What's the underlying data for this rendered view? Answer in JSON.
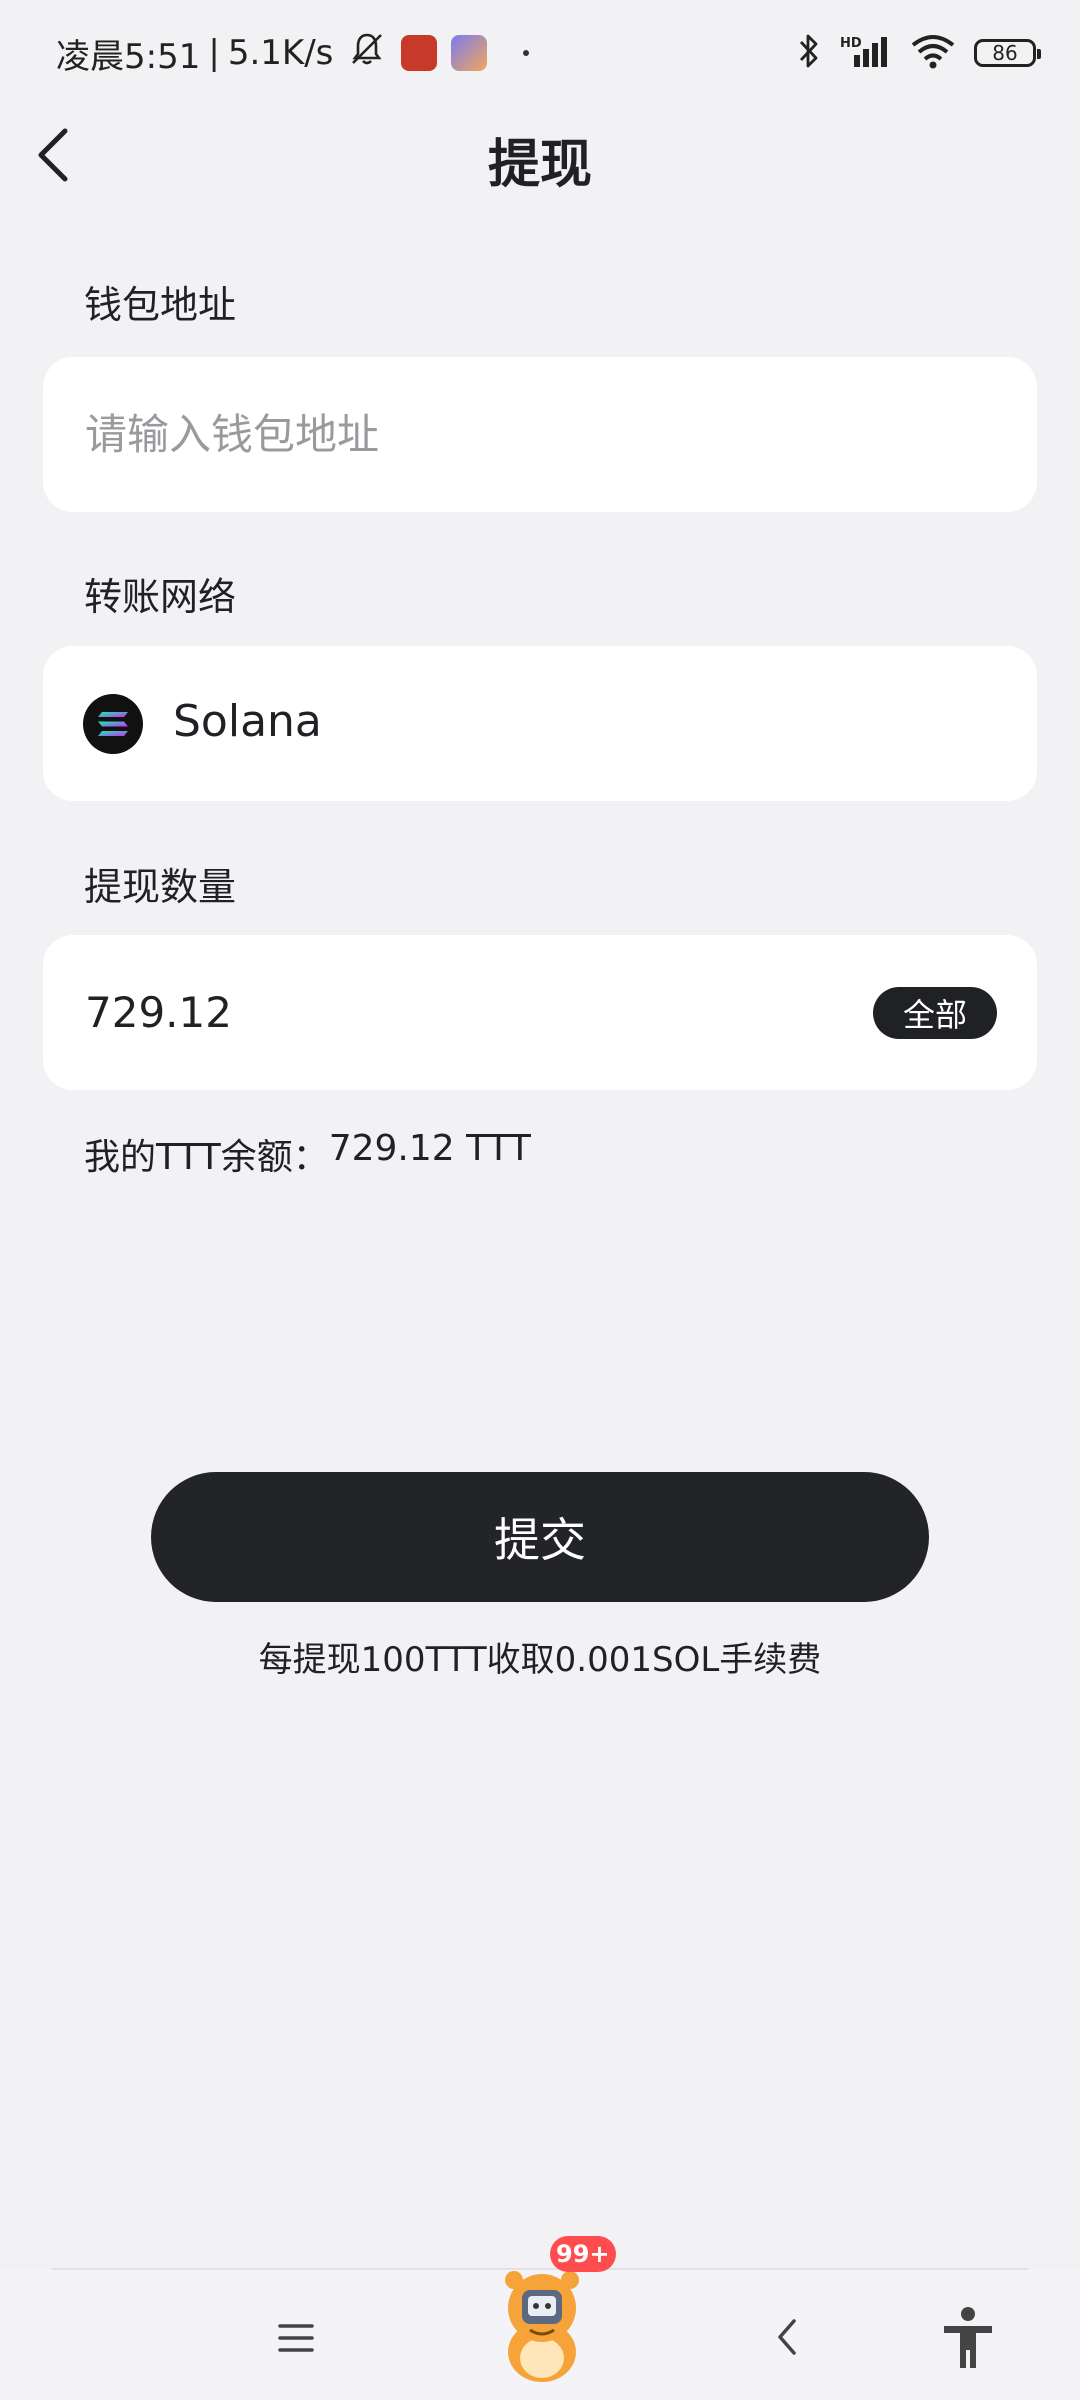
{
  "status_bar": {
    "time": "凌晨5:51",
    "separator": "|",
    "net_speed": "5.1K/s",
    "battery": "86",
    "signal_label": "HD"
  },
  "header": {
    "title": "提现"
  },
  "wallet": {
    "label": "钱包地址",
    "value": "",
    "placeholder": "请输入钱包地址"
  },
  "network": {
    "label": "转账网络",
    "selected": "Solana",
    "icon": "solana-icon"
  },
  "amount": {
    "label": "提现数量",
    "value": "729.12",
    "all_button": "全部"
  },
  "balance": {
    "prefix": "我的TTT余额：",
    "value": "729.12 TTT"
  },
  "submit": {
    "label": "提交"
  },
  "fee_note": "每提现100TTT收取0.001SOL手续费",
  "nav": {
    "badge": "99+"
  },
  "colors": {
    "background": "#f2f2f4",
    "card": "#ffffff",
    "primary": "#222428",
    "badge": "#ff4d4f"
  }
}
